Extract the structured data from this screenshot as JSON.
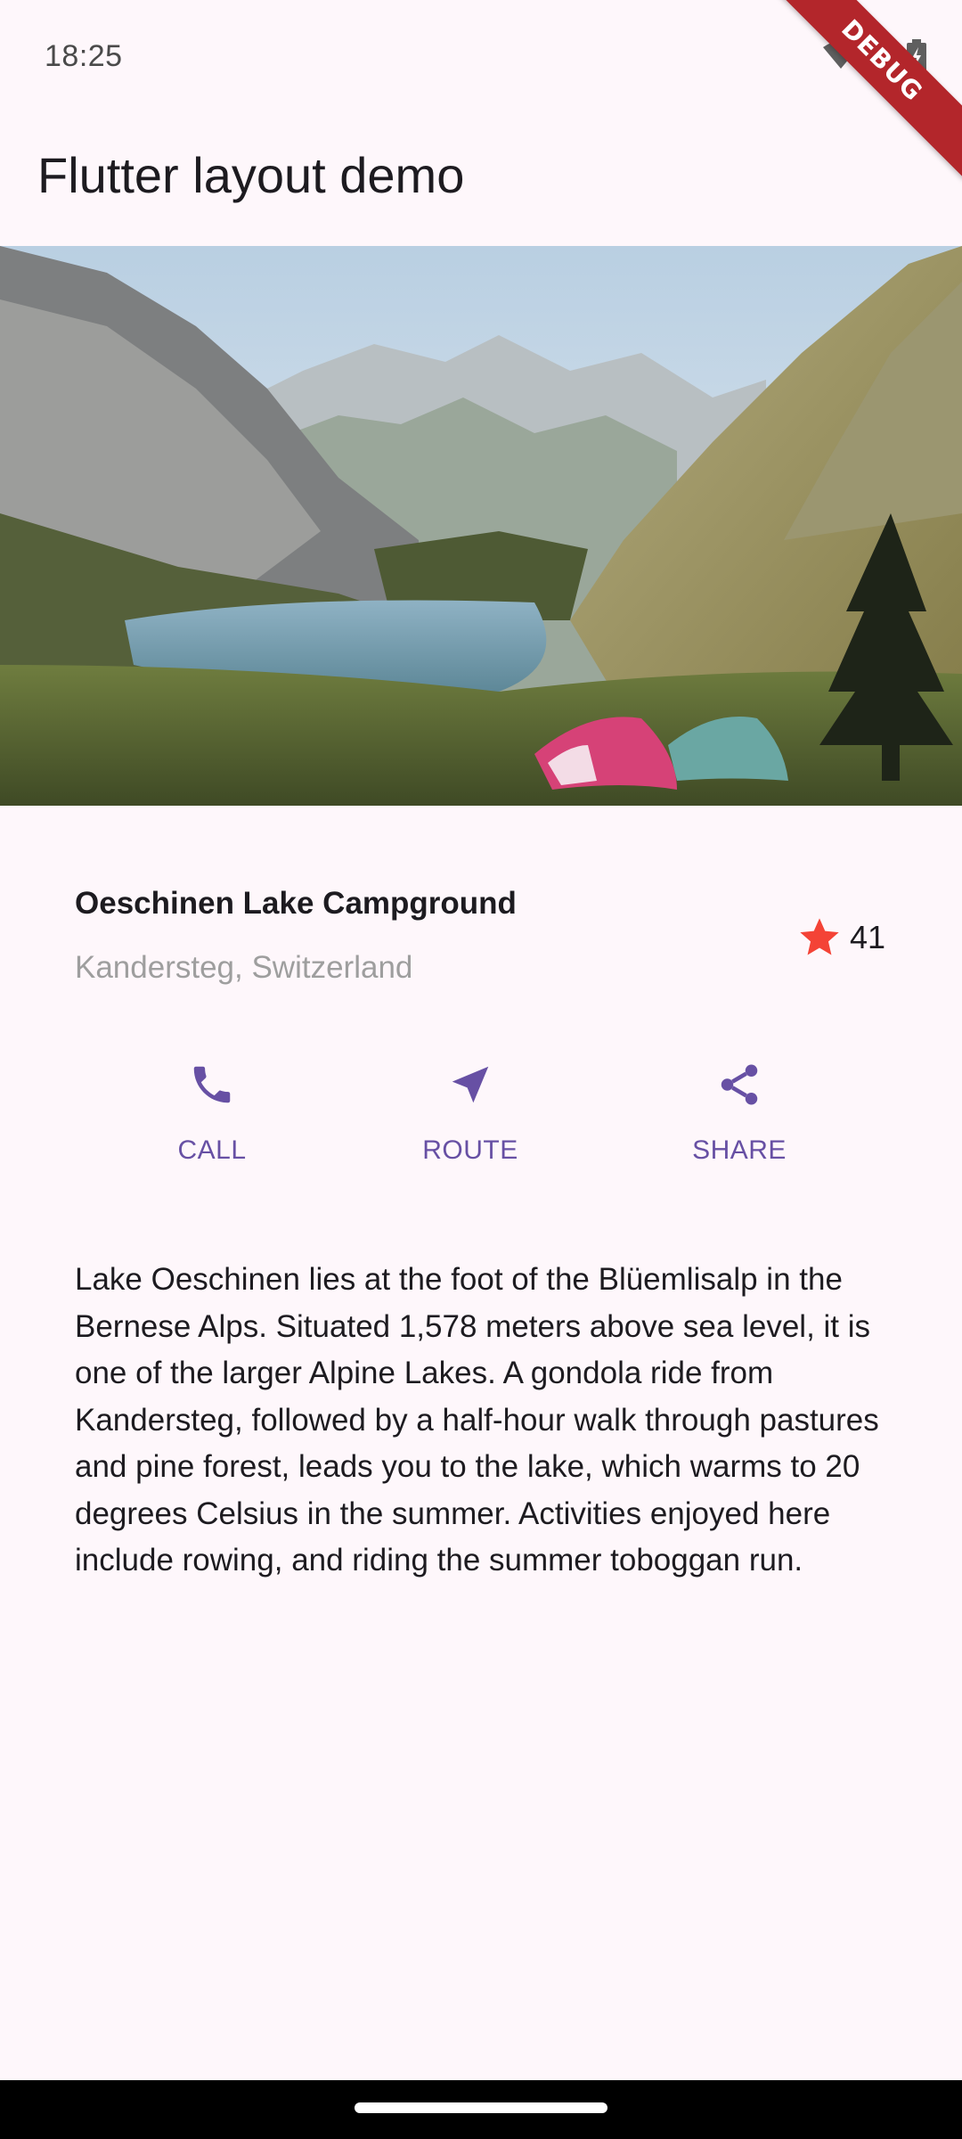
{
  "status_bar": {
    "time": "18:25",
    "icons": [
      "wifi-icon",
      "signal-icon",
      "battery-icon"
    ]
  },
  "debug_banner": "DEBUG",
  "app_bar": {
    "title": "Flutter layout demo"
  },
  "hero_image": {
    "icon": "lake-landscape-image"
  },
  "title_section": {
    "name": "Oeschinen Lake Campground",
    "location": "Kandersteg, Switzerland",
    "rating_count": "41",
    "rating_icon": "star-icon",
    "star_color": "#f44336"
  },
  "buttons": [
    {
      "label": "CALL",
      "icon": "phone-icon"
    },
    {
      "label": "ROUTE",
      "icon": "navigation-icon"
    },
    {
      "label": "SHARE",
      "icon": "share-icon"
    }
  ],
  "description": "Lake Oeschinen lies at the foot of the Blüemlisalp in the Bernese Alps. Situated 1,578 meters above sea level, it is one of the larger Alpine Lakes. A gondola ride from Kandersteg, followed by a half-hour walk through pastures and pine forest, leads you to the lake, which warms to 20 degrees Celsius in the summer. Activities enjoyed here include rowing, and riding the summer toboggan run.",
  "colors": {
    "accent": "#6750a4",
    "background": "#fef7fb",
    "secondary_text": "#9e9e9e"
  }
}
